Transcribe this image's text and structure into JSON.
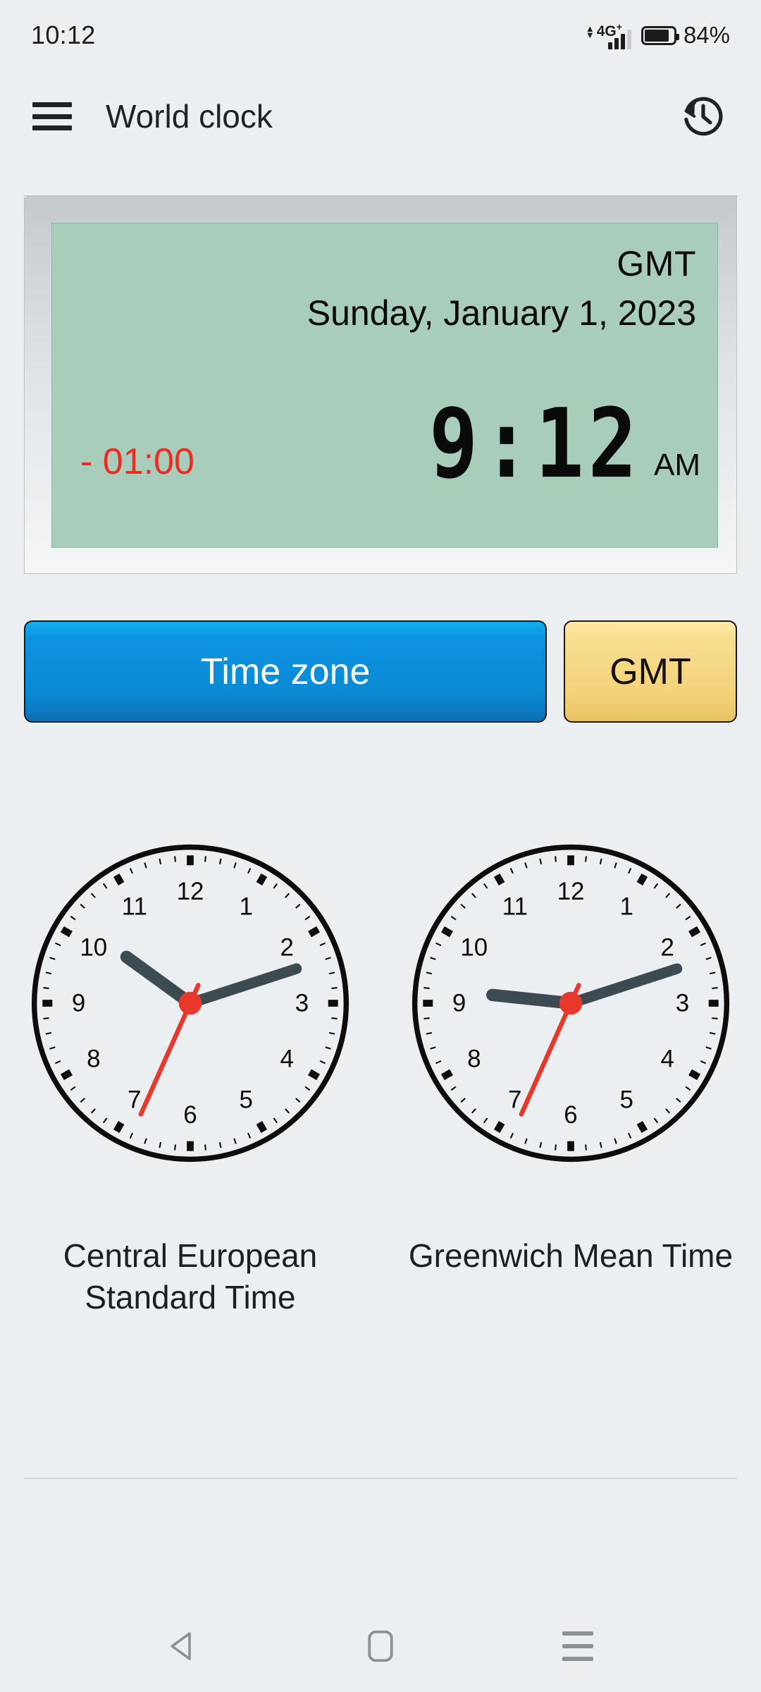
{
  "status_bar": {
    "time": "10:12",
    "network_type": "4G",
    "network_plus": "+",
    "battery_percent": "84%",
    "battery_level": 84,
    "icons": [
      "data-updown-icon",
      "signal-bars-icon",
      "battery-icon"
    ]
  },
  "app_bar": {
    "menu_icon": "hamburger-menu-icon",
    "title": "World clock",
    "history_icon": "history-clock-icon"
  },
  "lcd_display": {
    "timezone_abbr": "GMT",
    "date": "Sunday, January 1, 2023",
    "offset": "- 01:00",
    "offset_color": "#ef2a20",
    "time": "9:12",
    "meridiem": "AM",
    "screen_color": "#a9cdbb"
  },
  "buttons": {
    "timezone_label": "Time zone",
    "timezone_color": "#0b8ad4",
    "gmt_label": "GMT",
    "gmt_color": "#f3d27a"
  },
  "clocks": [
    {
      "name": "clock-central-european",
      "label": "Central European Standard Time",
      "hour_deg": 306,
      "minute_deg": 72,
      "second_deg": 204,
      "numerals": [
        "12",
        "1",
        "2",
        "3",
        "4",
        "5",
        "6",
        "7",
        "8",
        "9",
        "10",
        "11"
      ],
      "hand_color": "#3c4a52",
      "second_color": "#e8382c"
    },
    {
      "name": "clock-greenwich-mean",
      "label": "Greenwich Mean Time",
      "hour_deg": 276,
      "minute_deg": 72,
      "second_deg": 204,
      "numerals": [
        "12",
        "1",
        "2",
        "3",
        "4",
        "5",
        "6",
        "7",
        "8",
        "9",
        "10",
        "11"
      ],
      "hand_color": "#3c4a52",
      "second_color": "#e8382c"
    }
  ],
  "nav_bar": {
    "back_icon": "back-triangle-icon",
    "home_icon": "home-square-icon",
    "recents_icon": "recents-hamburger-icon"
  }
}
